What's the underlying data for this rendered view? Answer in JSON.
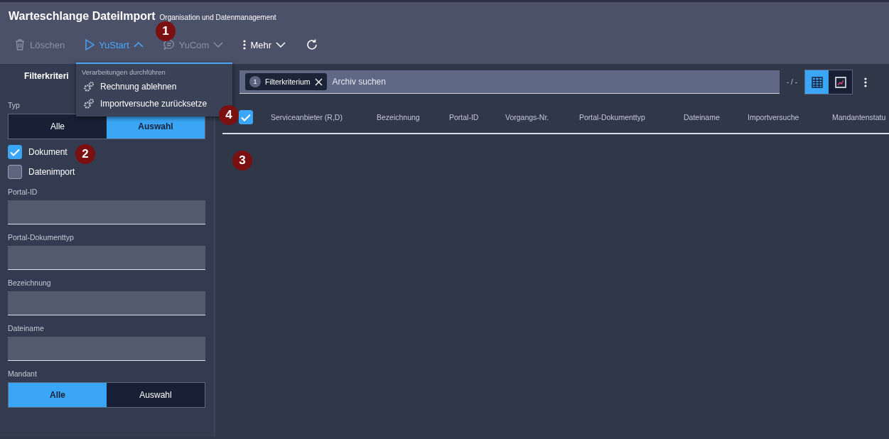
{
  "header": {
    "title": "Warteschlange DateiImport",
    "subtitle": "Organisation und Datenmanagement"
  },
  "toolbar": [
    {
      "kind": "trash",
      "label": "Löschen",
      "disabled": true
    },
    {
      "kind": "play",
      "label": "YuStart",
      "disabled": false,
      "expanded": true
    },
    {
      "kind": "chat",
      "label": "YuCom",
      "disabled": true,
      "expanded": false
    },
    {
      "kind": "more",
      "label": "Mehr",
      "disabled": false,
      "expanded": false
    },
    {
      "kind": "refresh",
      "disabled": false
    }
  ],
  "menu": {
    "heading": "Verarbeitungen durchführen",
    "items": [
      "Rechnung ablehnen",
      "Importversuche zurücksetze"
    ]
  },
  "sidebar": {
    "title": "Filterkriteri",
    "type_label": "Typ",
    "type_options": [
      {
        "label": "Alle",
        "selected": false
      },
      {
        "label": "Auswahl",
        "selected": true
      }
    ],
    "checks": [
      {
        "label": "Dokument",
        "checked": true
      },
      {
        "label": "Datenimport",
        "checked": false
      }
    ],
    "fields": [
      "Portal-ID",
      "Portal-Dokumenttyp",
      "Bezeichnung",
      "Dateiname"
    ],
    "mandant_label": "Mandant",
    "mandant_options": [
      {
        "label": "Alle",
        "selected": true
      },
      {
        "label": "Auswahl",
        "selected": false
      }
    ]
  },
  "search": {
    "chip_count": "1",
    "chip_label": "Filterkriterium",
    "placeholder": "Archiv suchen",
    "range": "- / -",
    "views": [
      {
        "kind": "table",
        "selected": true
      },
      {
        "kind": "chart",
        "selected": false
      }
    ]
  },
  "table": {
    "all_checked": true,
    "columns": [
      "Serviceanbieter (R,D)",
      "Bezeichnung",
      "Portal-ID",
      "Vorgangs-Nr.",
      "Portal-Dokumenttyp",
      "Dateiname",
      "Importversuche",
      "Mandantenstatu"
    ]
  },
  "callouts": [
    "1",
    "2",
    "3",
    "4"
  ]
}
